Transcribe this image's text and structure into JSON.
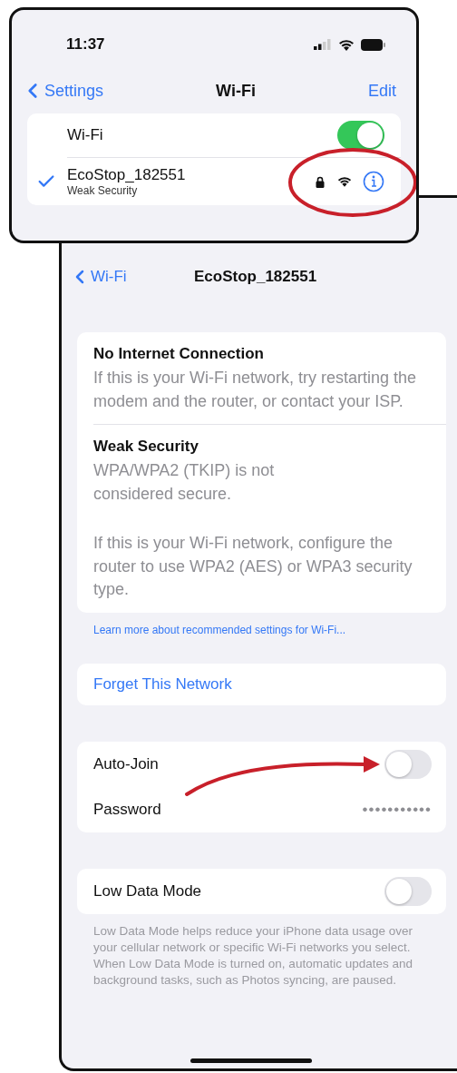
{
  "front": {
    "status_bar": {
      "time": "11:37"
    },
    "nav": {
      "back": "Settings",
      "title": "Wi-Fi",
      "action": "Edit"
    },
    "wifi_toggle": {
      "label": "Wi-Fi",
      "on": true
    },
    "network": {
      "name": "EcoStop_182551",
      "subtitle": "Weak Security",
      "connected": true,
      "highlighted": true
    }
  },
  "detail": {
    "nav": {
      "back": "Wi-Fi",
      "title": "EcoStop_182551"
    },
    "warnings": [
      {
        "title": "No Internet Connection",
        "paragraphs": [
          "If this is your Wi-Fi network, try restarting the modem and the router, or contact your ISP."
        ]
      },
      {
        "title": "Weak Security",
        "paragraphs": [
          "WPA/WPA2 (TKIP) is not\nconsidered secure.",
          "If this is your Wi-Fi network, configure the router to use WPA2 (AES) or WPA3 security type."
        ]
      }
    ],
    "learn_more_link": "Learn more about recommended settings for Wi-Fi...",
    "forget": "Forget This Network",
    "auto_join": {
      "label": "Auto-Join",
      "on": false,
      "pointed_at": true
    },
    "password": {
      "label": "Password",
      "value": "•••••••••••"
    },
    "low_data": {
      "label": "Low Data Mode",
      "on": false,
      "footer": "Low Data Mode helps reduce your iPhone data usage over your cellular network or specific Wi-Fi networks you select. When Low Data Mode is turned on, automatic updates and background tasks, such as Photos syncing, are paused."
    }
  }
}
